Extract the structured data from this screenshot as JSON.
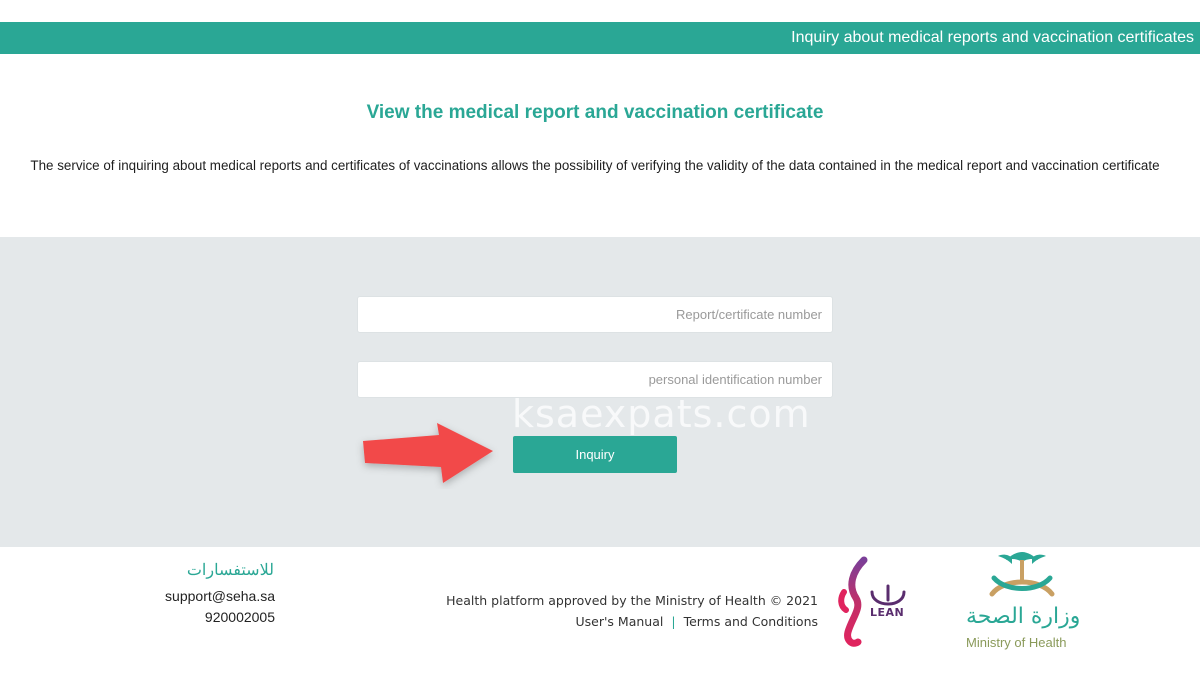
{
  "header": {
    "title": "Inquiry about medical reports and vaccination certificates"
  },
  "main": {
    "heading": "View the medical report and vaccination certificate",
    "description": "The service of inquiring about medical reports and certificates of vaccinations allows the possibility of verifying the validity of the data contained in the medical report and vaccination certificate"
  },
  "form": {
    "report_number": {
      "value": "",
      "placeholder": "Report/certificate number"
    },
    "personal_id": {
      "value": "",
      "placeholder": "personal identification number"
    },
    "submit_label": "Inquiry"
  },
  "watermark": "ksaexpats.com",
  "footer": {
    "contact_title": "للاستفسارات",
    "email": "support@seha.sa",
    "phone": "920002005",
    "copyright": "Health platform approved by the Ministry of Health © 2021",
    "links": {
      "manual": "User's Manual",
      "separator": "|",
      "terms": "Terms and Conditions"
    },
    "lean_logo_text": "LEAN",
    "moh_logo": {
      "arabic": "وزارة الصحة",
      "english": "Ministry of Health"
    }
  },
  "colors": {
    "brand_teal": "#2aa795",
    "panel_gray": "#e4e8ea",
    "arrow_red": "#f24a4a"
  },
  "icons": {
    "annotation_arrow": "right-arrow-icon"
  }
}
